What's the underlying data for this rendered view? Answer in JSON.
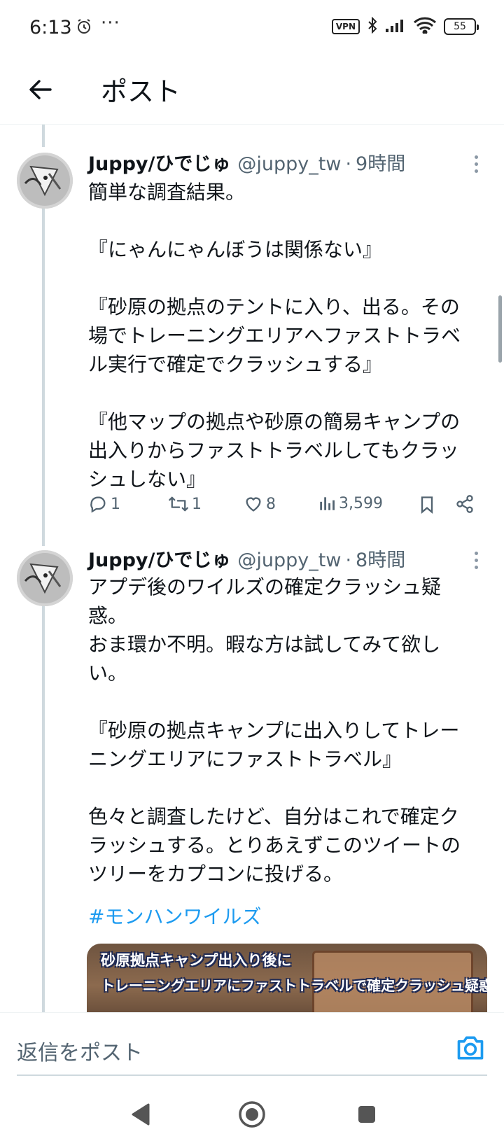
{
  "status_bar": {
    "time": "6:13",
    "more": "···",
    "vpn": "VPN",
    "battery": "55"
  },
  "header": {
    "title": "ポスト"
  },
  "tweets": [
    {
      "display_name": "Juppy/ひでじゅ",
      "handle": "@juppy_tw",
      "dot": "·",
      "time": "9時間",
      "text": "簡単な調査結果。\n\n『にゃんにゃんぼうは関係ない』\n\n『砂原の拠点のテントに入り、出る。その\n場でトレーニングエリアへファストトラベ\nル実行で確定でクラッシュする』\n\n『他マップの拠点や砂原の簡易キャンプの\n出入りからファストトラベルしてもクラッ\nシュしない』",
      "replies": "1",
      "reposts": "1",
      "likes": "8",
      "views": "3,599"
    },
    {
      "display_name": "Juppy/ひでじゅ",
      "handle": "@juppy_tw",
      "dot": "·",
      "time": "8時間",
      "text": "アプデ後のワイルズの確定クラッシュ疑\n惑。\nおま環か不明。暇な方は試してみて欲し\nい。\n\n『砂原の拠点キャンプに出入りしてトレー\nニングエリアにファストトラベル』\n\n色々と調査したけど、自分はこれで確定ク\nラッシュする。とりあえずこのツイートの\nツリーをカプコンに投げる。",
      "hashtag": "#モンハンワイルズ",
      "media_line1": "砂原拠点キャンプ出入り後に",
      "media_line2": "トレーニングエリアにファストトラベルで確定クラッシュ疑惑"
    }
  ],
  "reply_bar": {
    "placeholder": "返信をポスト"
  },
  "colors": {
    "accent": "#1d9bf0",
    "text": "#0f1419",
    "secondary": "#536471",
    "thread_line": "#cfd9de"
  }
}
